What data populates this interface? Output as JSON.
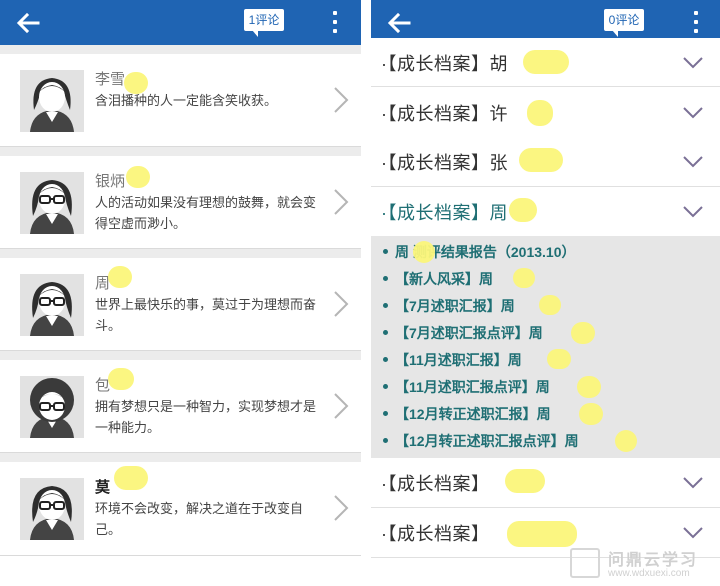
{
  "left": {
    "comment_badge": "1评论",
    "people": [
      {
        "name": "李雪",
        "text": "含泪播种的人一定能含笑收获。",
        "avatar": "female-avatar-icon"
      },
      {
        "name": "银炳",
        "text": "人的活动如果没有理想的鼓舞，就会变得空虚而渺小。",
        "avatar": "female-glasses-avatar-icon"
      },
      {
        "name": "周",
        "text": "世界上最快乐的事，莫过于为理想而奋斗。",
        "avatar": "female-glasses-avatar-icon"
      },
      {
        "name": "包",
        "text": "拥有梦想只是一种智力，实现梦想才是一种能力。",
        "avatar": "female-curly-avatar-icon"
      },
      {
        "name": "莫",
        "text": "环境不会改变，解决之道在于改变自己。",
        "avatar": "female-glasses-avatar-icon"
      }
    ]
  },
  "right": {
    "comment_badge": "0评论",
    "rows": [
      {
        "label": "·【成长档案】胡"
      },
      {
        "label": "·【成长档案】许"
      },
      {
        "label": "·【成长档案】张"
      },
      {
        "label": "·【成长档案】周"
      },
      {
        "label": "·【成长档案】"
      },
      {
        "label": "·【成长档案】"
      }
    ],
    "sub_items": [
      "周 测评结果报告（2013.10）",
      "【新人风采】周",
      "【7月述职汇报】周",
      "【7月述职汇报点评】周",
      "【11月述职汇报】周",
      "【11月述职汇报点评】周",
      "【12月转正述职汇报】周",
      "【12月转正述职汇报点评】周"
    ]
  },
  "watermark": {
    "title": "问鼎云学习",
    "url": "www.wdxuexi.com"
  },
  "colors": {
    "appbar": "#1f64b3",
    "accent": "#1f6f74",
    "highlight": "#fbf57a"
  }
}
